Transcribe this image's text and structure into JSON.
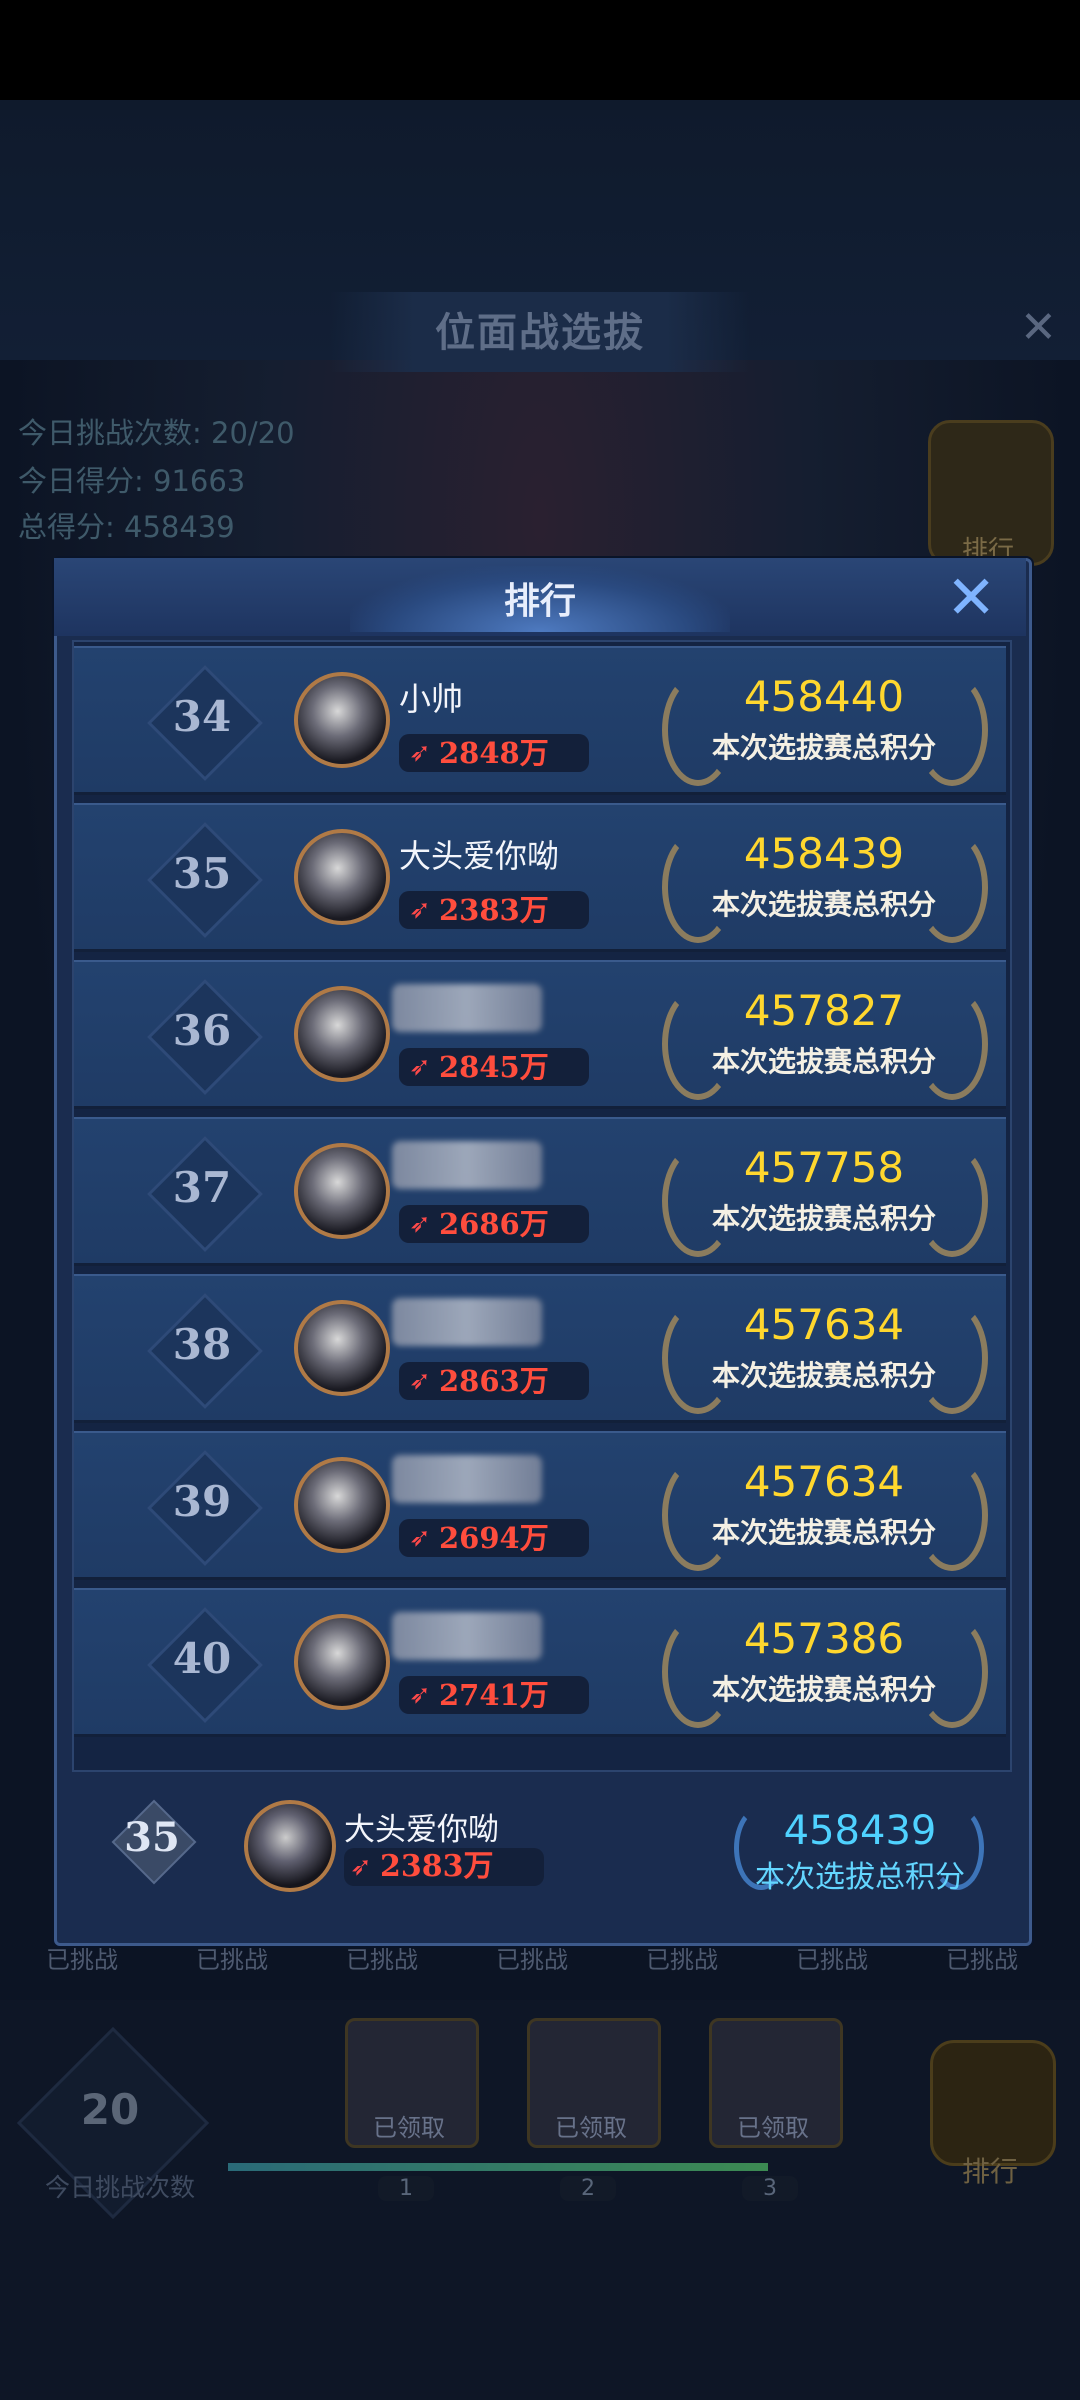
{
  "background": {
    "title": "位面战选拔",
    "stats": {
      "challenges_today": "今日挑战次数: 20/20",
      "score_today": "今日得分: 91663",
      "total_score": "总得分: 458439"
    },
    "rank_button_label": "排行",
    "challenge_chips": [
      "已挑战",
      "已挑战",
      "已挑战",
      "已挑战",
      "已挑战",
      "已挑战",
      "已挑战"
    ],
    "attempts_count": "20",
    "attempts_label": "今日挑战次数",
    "chests": [
      {
        "label": "已领取",
        "number": "1"
      },
      {
        "label": "已领取",
        "number": "2"
      },
      {
        "label": "已领取",
        "number": "3"
      }
    ],
    "progress_fraction": 1.0,
    "trophy_label": "排行"
  },
  "modal": {
    "title": "排行",
    "close_icon": "close-icon",
    "score_caption": "本次选拔赛总积分",
    "rows": [
      {
        "rank": "34",
        "name": "小帅",
        "power": "2848万",
        "score": "458440",
        "name_blurred": false
      },
      {
        "rank": "35",
        "name": "大头爱你呦",
        "power": "2383万",
        "score": "458439",
        "name_blurred": false
      },
      {
        "rank": "36",
        "name": "",
        "power": "2845万",
        "score": "457827",
        "name_blurred": true
      },
      {
        "rank": "37",
        "name": "",
        "power": "2686万",
        "score": "457758",
        "name_blurred": true
      },
      {
        "rank": "38",
        "name": "",
        "power": "2863万",
        "score": "457634",
        "name_blurred": true
      },
      {
        "rank": "39",
        "name": "",
        "power": "2694万",
        "score": "457634",
        "name_blurred": true
      },
      {
        "rank": "40",
        "name": "",
        "power": "2741万",
        "score": "457386",
        "name_blurred": true
      }
    ],
    "self": {
      "rank": "35",
      "name": "大头爱你呦",
      "power": "2383万",
      "score": "458439",
      "score_caption": "本次选拔总积分"
    }
  },
  "colors": {
    "score_gold": "#ffd72e",
    "power_red": "#ff4d3d",
    "self_score_cyan": "#4fd2ff"
  }
}
